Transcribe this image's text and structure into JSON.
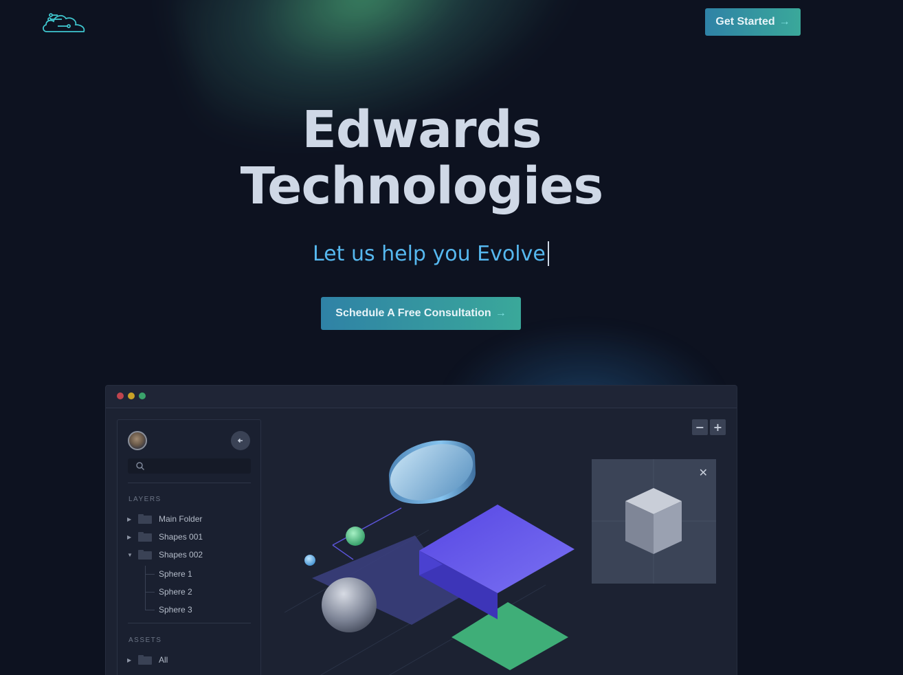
{
  "header": {
    "logo_icon": "cloud-circuit-icon",
    "get_started_label": "Get Started",
    "arrow_glyph": "→"
  },
  "hero": {
    "title_line1": "Edwards",
    "title_line2": "Technologies",
    "tagline": "Let us help you Evolve",
    "cta_label": "Schedule A Free Consultation",
    "cta_arrow": "→"
  },
  "app_window": {
    "sidebar": {
      "back_icon": "arrow-left-icon",
      "search_placeholder": "",
      "layers_label": "LAYERS",
      "layers": [
        {
          "label": "Main Folder",
          "expanded": false
        },
        {
          "label": "Shapes 001",
          "expanded": false
        },
        {
          "label": "Shapes 002",
          "expanded": true
        }
      ],
      "children": [
        "Sphere 1",
        "Sphere 2",
        "Sphere 3"
      ],
      "assets_label": "ASSETS",
      "assets": [
        {
          "label": "All"
        }
      ]
    },
    "zoom_out_label": "−",
    "zoom_in_label": "+",
    "preview_close_label": "✕"
  },
  "colors": {
    "background": "#0d1220",
    "accent_blue": "#56b8ef",
    "button_gradient_start": "#2f82a6",
    "button_gradient_end": "#3aa89a",
    "purple_shape": "#5b4fe0",
    "green_shape": "#3fae78"
  }
}
